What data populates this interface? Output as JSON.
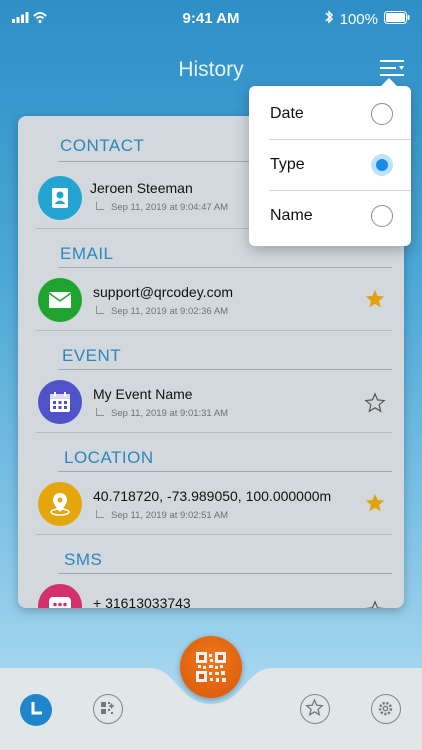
{
  "status_bar": {
    "time": "9:41 AM",
    "battery": "100%"
  },
  "header": {
    "title": "History"
  },
  "sections": [
    {
      "label": "CONTACT",
      "title": "Jeroen Steeman",
      "time": "Sep 11, 2019 at 9:04:47 AM",
      "starred": null,
      "icon": "person-icon",
      "color": "#23a4d2"
    },
    {
      "label": "EMAIL",
      "title": "support@qrcodey.com",
      "time": "Sep 11, 2019 at 9:02:36 AM",
      "starred": true,
      "icon": "envelope-icon",
      "color": "#1fa52f"
    },
    {
      "label": "EVENT",
      "title": "My Event Name",
      "time": "Sep 11, 2019 at 9:01:31 AM",
      "starred": false,
      "icon": "calendar-icon",
      "color": "#4f52c9"
    },
    {
      "label": "LOCATION",
      "title": "40.718720, -73.989050, 100.000000m",
      "time": "Sep 11, 2019 at 9:02:51 AM",
      "starred": true,
      "icon": "location-pin-icon",
      "color": "#e5a50d"
    },
    {
      "label": "SMS",
      "title": "+ 31613033743",
      "time": "",
      "starred": false,
      "icon": "chat-bubble-icon",
      "color": "#d4306f"
    }
  ],
  "sort_menu": {
    "options": [
      {
        "label": "Date",
        "selected": false
      },
      {
        "label": "Type",
        "selected": true
      },
      {
        "label": "Name",
        "selected": false
      }
    ]
  },
  "tab_bar": {
    "tabs": [
      "history-tab",
      "generate-tab",
      "scan-button",
      "favorites-tab",
      "settings-tab"
    ],
    "active": "history-tab"
  },
  "colors": {
    "accent": "#2c86bf",
    "star": "#e0a30f",
    "scan": "#e5630f"
  }
}
